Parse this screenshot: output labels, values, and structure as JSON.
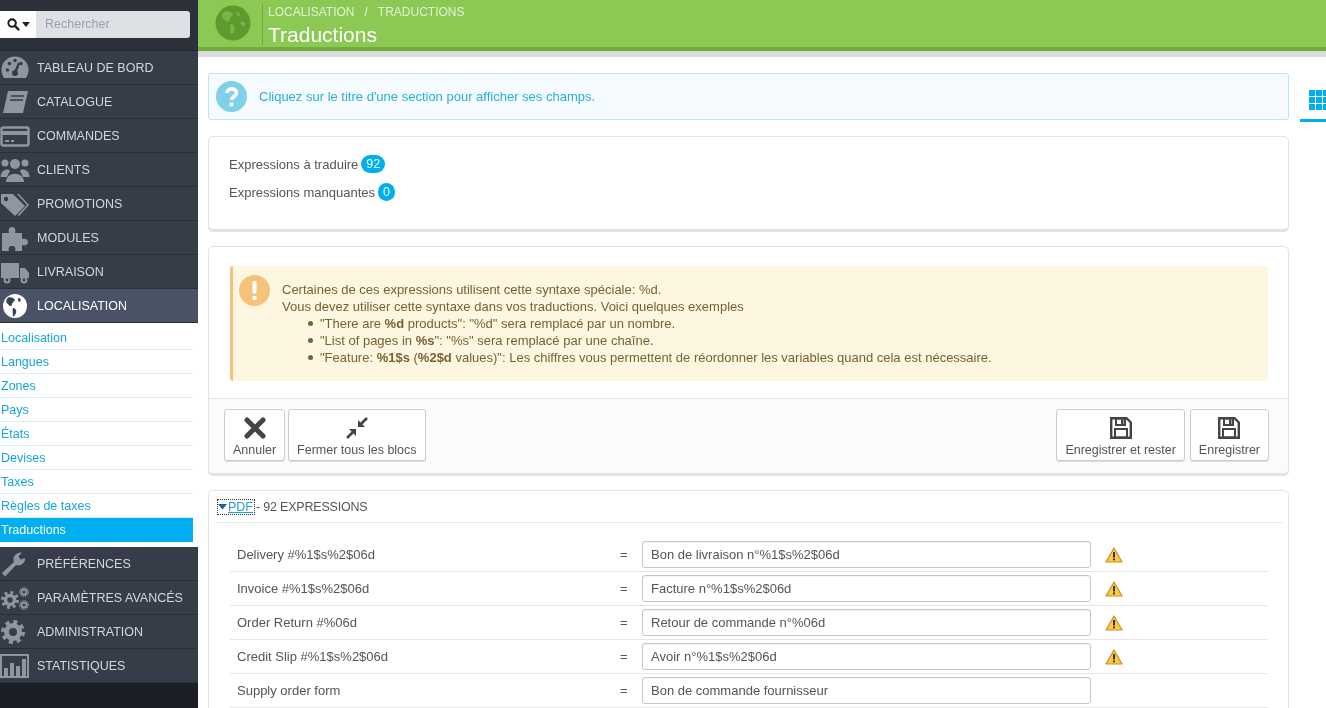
{
  "sidebar": {
    "search": {
      "placeholder": "Rechercher"
    },
    "menu": [
      {
        "label": "TABLEAU DE BORD",
        "selected": false
      },
      {
        "label": "CATALOGUE",
        "selected": false
      },
      {
        "label": "COMMANDES",
        "selected": false
      },
      {
        "label": "CLIENTS",
        "selected": false
      },
      {
        "label": "PROMOTIONS",
        "selected": false
      },
      {
        "label": "MODULES",
        "selected": false
      },
      {
        "label": "LIVRAISON",
        "selected": false
      },
      {
        "label": "LOCALISATION",
        "selected": true,
        "children": [
          {
            "label": "Localisation",
            "selected": false
          },
          {
            "label": "Langues",
            "selected": false
          },
          {
            "label": "Zones",
            "selected": false
          },
          {
            "label": "Pays",
            "selected": false
          },
          {
            "label": "États",
            "selected": false
          },
          {
            "label": "Devises",
            "selected": false
          },
          {
            "label": "Taxes",
            "selected": false
          },
          {
            "label": "Règles de taxes",
            "selected": false
          },
          {
            "label": "Traductions",
            "selected": true
          }
        ]
      },
      {
        "label": "PRÉFÉRENCES",
        "selected": false
      },
      {
        "label": "PARAMÈTRES AVANCÉS",
        "selected": false
      },
      {
        "label": "ADMINISTRATION",
        "selected": false
      },
      {
        "label": "STATISTIQUES",
        "selected": false
      }
    ]
  },
  "header": {
    "breadcrumb": [
      "LOCALISATION",
      "TRADUCTIONS"
    ],
    "separator": "/",
    "title": "Traductions"
  },
  "view_tabs": [
    {
      "selected": true
    }
  ],
  "info_alert": {
    "text": "Cliquez sur le titre d'une section pour afficher ses champs."
  },
  "stats": [
    {
      "label": "Expressions à traduire",
      "count": "92"
    },
    {
      "label": "Expressions manquantes",
      "count": "0"
    }
  ],
  "warning_alert": {
    "lines": [
      "Certaines de ces expressions utilisent cette syntaxe spéciale: %d.",
      "Vous devez utiliser cette syntaxe dans vos traductions. Voici quelques exemples"
    ],
    "examples": [
      "\"There are **%d** products\": \"%d\" sera remplacé par un nombre.",
      "\"List of pages in **%s**\": \"%s\" sera remplacé par une chaîne.",
      "\"Feature: **%1$s** (**%2$d** values)\": Les chiffres vous permettent de réordonner les variables quand cela est nécessaire."
    ]
  },
  "toolbar": {
    "left": [
      {
        "label": "Annuler"
      },
      {
        "label": "Fermer tous les blocs"
      }
    ],
    "right": [
      {
        "label": "Enregistrer et rester"
      },
      {
        "label": "Enregistrer"
      }
    ]
  },
  "section": {
    "title": "PDF",
    "count_label": "- 92 EXPRESSIONS",
    "expanded": true,
    "rows": [
      {
        "source": "Delivery #%1$s%2$06d",
        "equals": "=",
        "value": "Bon de livraison n°%1$s%2$06d",
        "warning": true
      },
      {
        "source": "Invoice #%1$s%2$06d",
        "equals": "=",
        "value": "Facture n°%1$s%2$06d",
        "warning": true
      },
      {
        "source": "Order Return #%06d",
        "equals": "=",
        "value": "Retour de commande n°%06d",
        "warning": true
      },
      {
        "source": "Credit Slip #%1$s%2$06d",
        "equals": "=",
        "value": "Avoir n°%1$s%2$06d",
        "warning": true
      },
      {
        "source": "Supply order form",
        "equals": "=",
        "value": "Bon de commande fournisseur",
        "warning": false
      }
    ]
  }
}
